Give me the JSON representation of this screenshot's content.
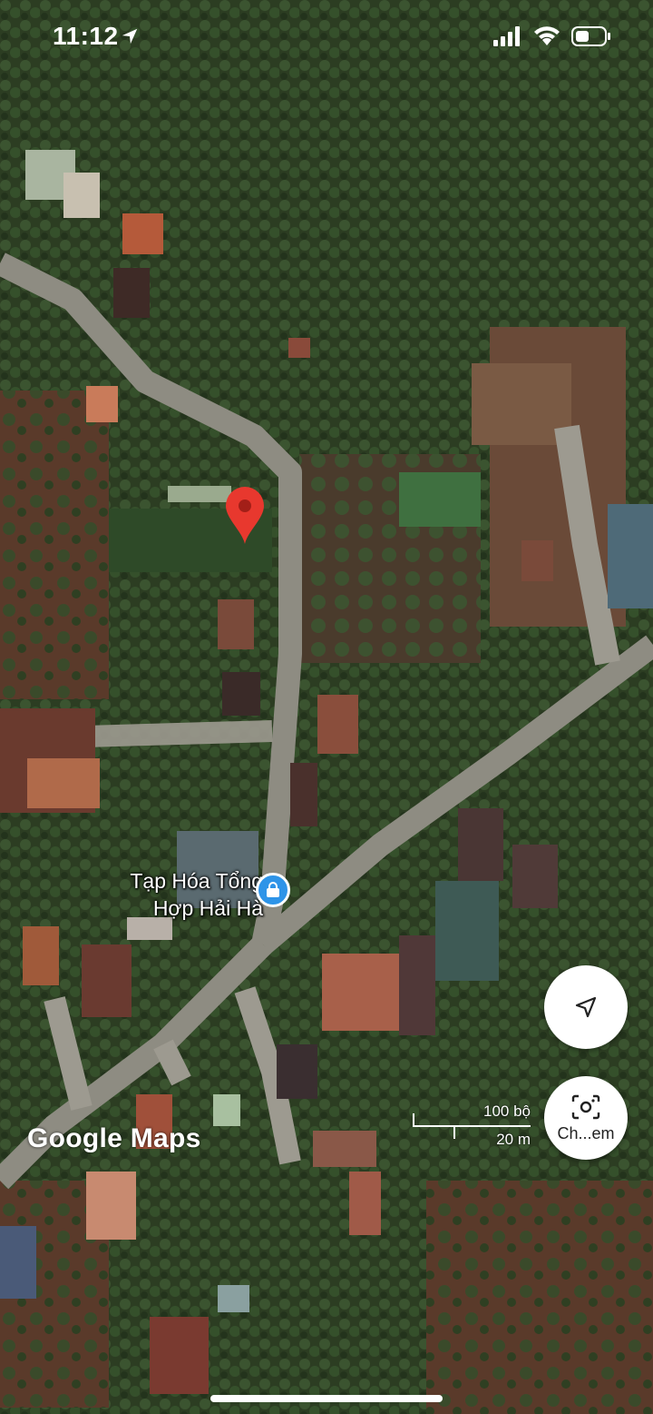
{
  "status_bar": {
    "time": "11:12",
    "icons": [
      "location-arrow-icon",
      "signal-icon",
      "wifi-icon",
      "battery-icon"
    ]
  },
  "map": {
    "type": "satellite",
    "poi": {
      "label_line1": "Tạp Hóa Tổng",
      "label_line2": "Hợp Hải Hà",
      "icon": "shopping-bag-icon",
      "color": "#2e94e8"
    },
    "dropped_pin": {
      "icon": "red-map-pin-icon",
      "color": "#e8382e"
    },
    "scale": {
      "imperial": "100 bộ",
      "metric": "20 m"
    },
    "watermark": "Google Maps"
  },
  "controls": {
    "my_location_icon": "navigation-arrow-icon",
    "lens": {
      "icon": "camera-search-icon",
      "label": "Ch...em"
    }
  }
}
